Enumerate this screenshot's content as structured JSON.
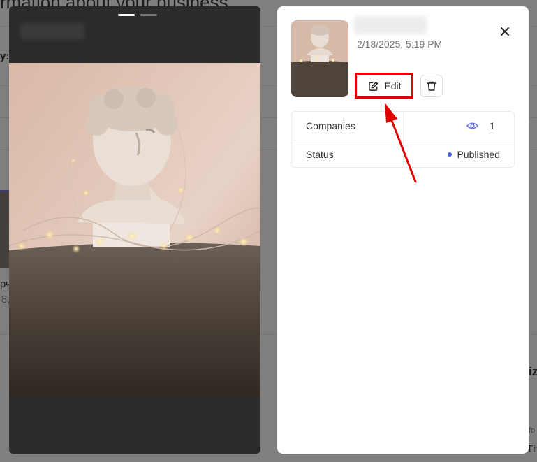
{
  "background_page": {
    "title_fragment": "rmation about your business",
    "label_fragment": "y:",
    "item_fragment_1": "рч",
    "item_fragment_2": "8,",
    "side_fragment_1": "iz",
    "side_fragment_2": "fo",
    "side_fragment_3": "Th"
  },
  "viewer": {
    "progress_segments": 2,
    "active_segment": 1,
    "image_icon": "classical-bust-with-fairy-lights-photo"
  },
  "panel": {
    "date": "2/18/2025, 5:19 PM",
    "edit_label": "Edit",
    "close_icon": "close-icon",
    "edit_icon": "pencil-square-icon",
    "delete_icon": "trash-icon",
    "rows": [
      {
        "label": "Companies",
        "icon": "eye-icon",
        "value": "1"
      },
      {
        "label": "Status",
        "value": "Published"
      }
    ]
  },
  "colors": {
    "annotation_red": "#e00000",
    "status_dot": "#4a5fd8",
    "eye_icon": "#5b6ee8"
  }
}
